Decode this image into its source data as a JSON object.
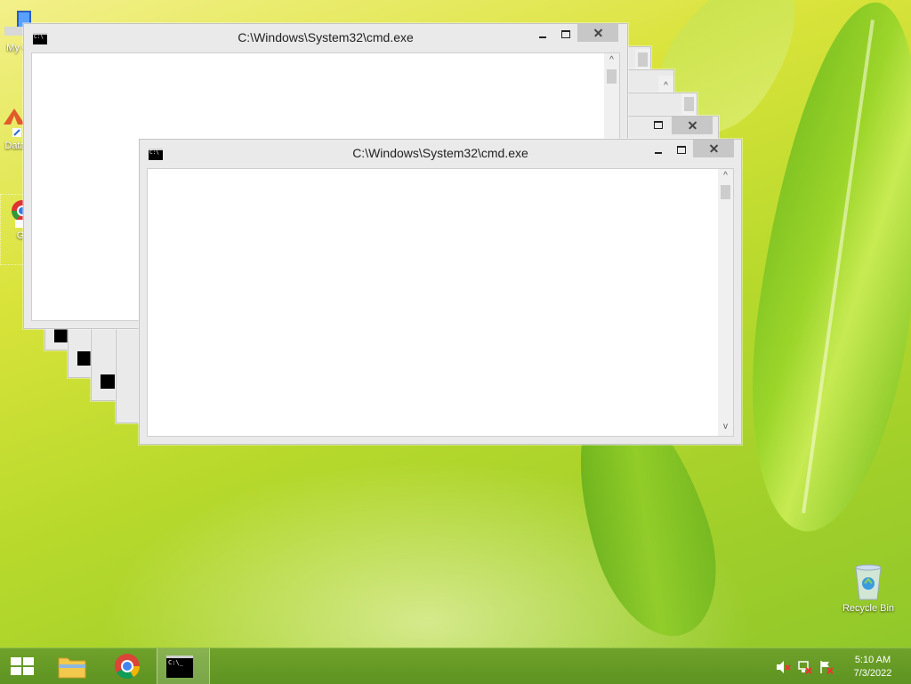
{
  "desktop": {
    "icons": [
      {
        "label": "My C",
        "icon": "computer-icon"
      },
      {
        "label": "Data",
        "icon": "data-shortcut-icon"
      },
      {
        "label": "G",
        "icon": "chrome-shortcut-icon"
      },
      {
        "label": "Recycle Bin",
        "icon": "recycle-bin-icon"
      }
    ]
  },
  "windows": [
    {
      "title": "C:\\Windows\\System32\\cmd.exe",
      "role": "back"
    },
    {
      "title": "C:\\Windows\\System32\\cmd.exe",
      "role": "front"
    }
  ],
  "scrollbar": {
    "up_arrow": "^",
    "down_arrow": "v"
  },
  "taskbar": {
    "pinned": [
      {
        "name": "start-button",
        "icon": "windows-logo-icon"
      },
      {
        "name": "file-explorer",
        "icon": "folder-icon"
      },
      {
        "name": "chrome",
        "icon": "chrome-icon"
      },
      {
        "name": "command-prompt",
        "icon": "cmd-icon"
      }
    ],
    "tray_icons": [
      "volume-muted-icon",
      "network-icon",
      "action-center-flag-icon"
    ],
    "clock": {
      "time": "5:10 AM",
      "date": "7/3/2022"
    }
  },
  "colors": {
    "accent": "#6fa22a",
    "window_bg": "#eaeaea",
    "close_button": "#c7c7c7"
  }
}
